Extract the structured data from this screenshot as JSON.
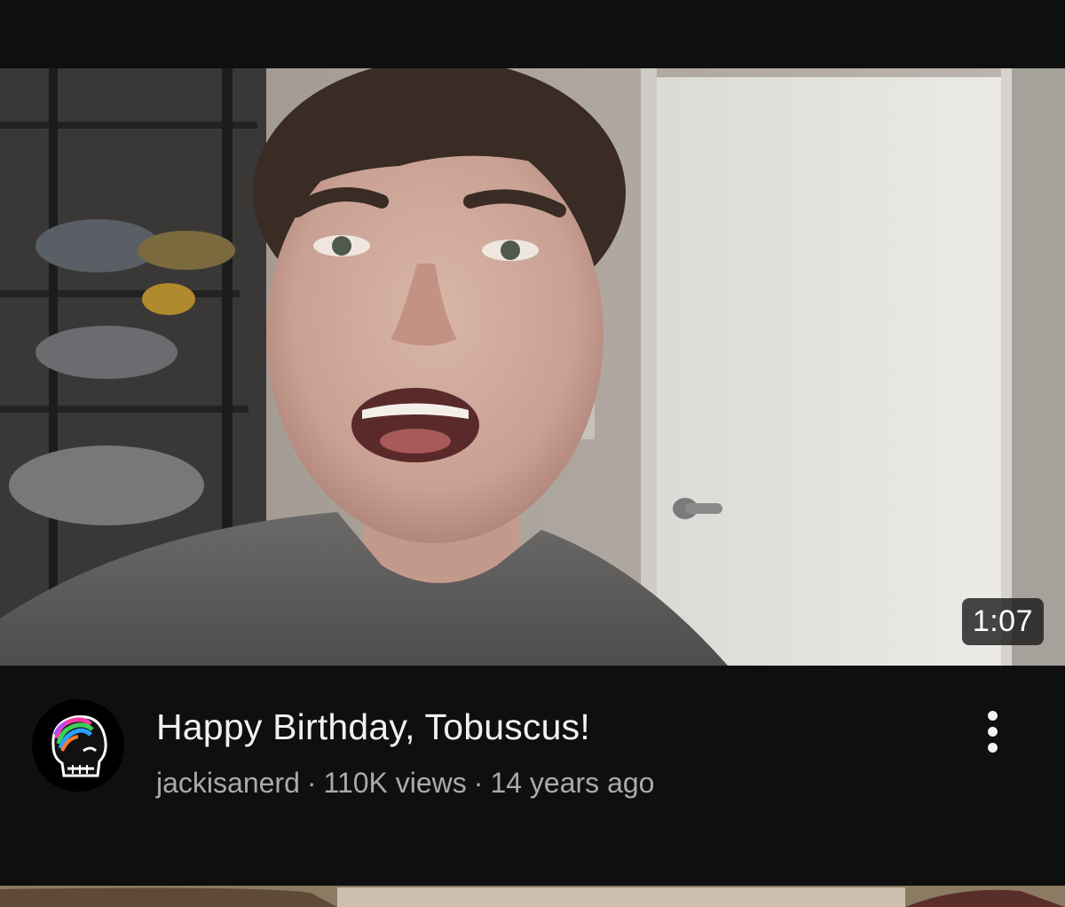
{
  "status_bar": {},
  "video": {
    "duration": "1:07",
    "title": "Happy Birthday, Tobuscus!",
    "channel": "jackisanerd",
    "views": "110K views",
    "age": "14 years ago",
    "separator": "·"
  },
  "icons": {
    "more": "more-vert-icon",
    "avatar": "channel-avatar"
  },
  "colors": {
    "background": "#0f0f0f",
    "title_text": "#f1f1f1",
    "secondary_text": "#aaaaaa",
    "badge_bg": "#141414"
  }
}
